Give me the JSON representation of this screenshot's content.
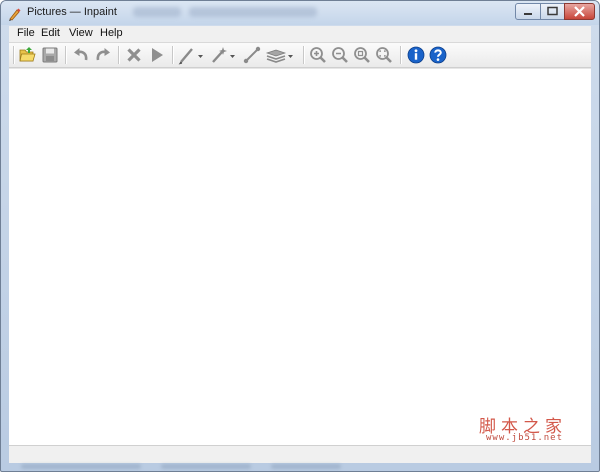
{
  "window": {
    "title": "Pictures — Inpaint"
  },
  "menu": {
    "items": [
      "File",
      "Edit",
      "View",
      "Help"
    ]
  },
  "toolbar": {
    "icons": [
      "open-icon",
      "save-icon",
      "undo-icon",
      "redo-icon",
      "delete-icon",
      "play-icon",
      "marker-icon",
      "magic-wand-icon",
      "line-icon",
      "layers-icon",
      "zoom-in-icon",
      "zoom-out-icon",
      "zoom-actual-icon",
      "zoom-fit-icon",
      "info-icon",
      "help-icon"
    ]
  },
  "watermark": {
    "chinese": "脚本之家",
    "url": "www.jb51.net"
  },
  "colors": {
    "accent": "#1a63c9",
    "watermark": "#d3584a"
  }
}
